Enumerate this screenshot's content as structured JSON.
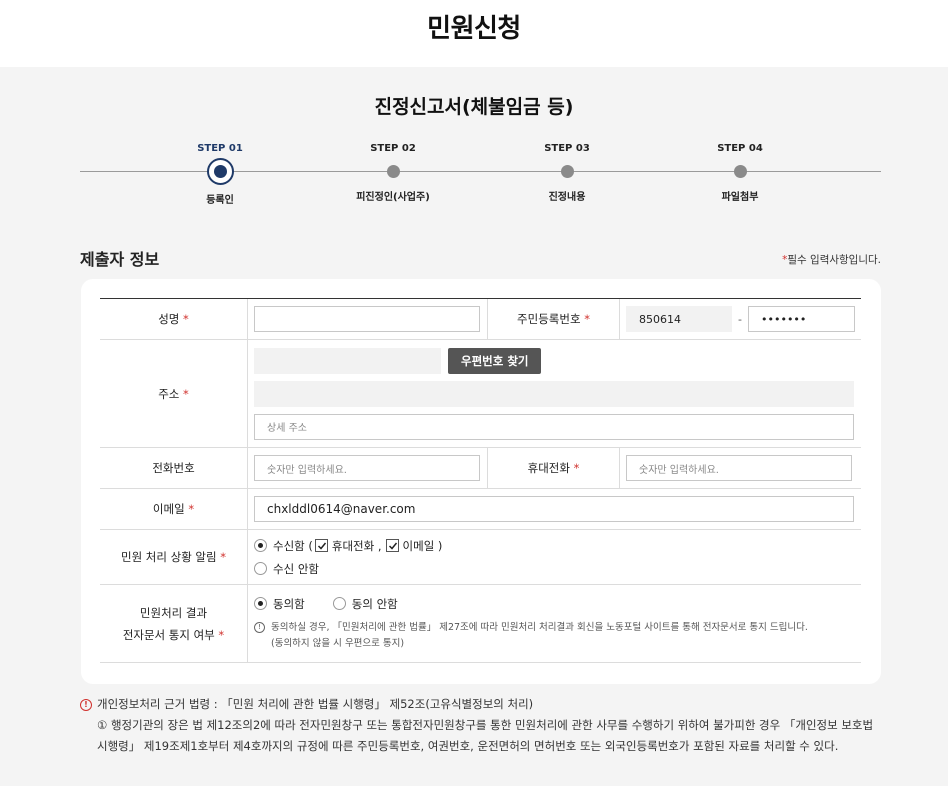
{
  "page": {
    "title": "민원신청",
    "form_title": "진정신고서(체불임금 등)"
  },
  "steps": [
    {
      "label": "STEP 01",
      "name": "등록인"
    },
    {
      "label": "STEP 02",
      "name": "피진정인(사업주)"
    },
    {
      "label": "STEP 03",
      "name": "진정내용"
    },
    {
      "label": "STEP 04",
      "name": "파일첨부"
    }
  ],
  "section": {
    "title": "제출자 정보",
    "required_star": "*",
    "required_note": "필수 입력사항입니다."
  },
  "fields": {
    "name": {
      "label": "성명",
      "value": ""
    },
    "rrn": {
      "label": "주민등록번호",
      "front": "850614",
      "sep": "-",
      "back": "•••••••"
    },
    "address": {
      "label": "주소",
      "zip_button": "우편번호 찾기",
      "detail_placeholder": "상세 주소"
    },
    "phone": {
      "label": "전화번호",
      "placeholder": "숫자만 입력하세요."
    },
    "mobile": {
      "label": "휴대전화",
      "placeholder": "숫자만 입력하세요."
    },
    "email": {
      "label": "이메일",
      "value": "chxlddl0614@naver.com"
    },
    "notify": {
      "label": "민원 처리 상황 알림",
      "receive": "수신함 (",
      "mobile": "휴대전화 ,",
      "email": "이메일 )",
      "no_receive": "수신 안함"
    },
    "edoc": {
      "label_line1": "민원처리 결과",
      "label_line2": "전자문서 통지 여부",
      "agree": "동의함",
      "disagree": "동의 안함",
      "notice_line1": "동의하실 경우, 「민원처리에 관한 법률」 제27조에 따라 민원처리 처리결과 회신을 노동포털 사이트를 통해 전자문서로 통지 드립니다.",
      "notice_line2": "(동의하지 않을 시 우편으로 통지)"
    }
  },
  "bottom_notice": {
    "head": "개인정보처리 근거 법령 : 「민원 처리에 관한 법률 시행령」 제52조(고유식별정보의 처리)",
    "body": "① 행정기관의 장은 법 제12조의2에 따라 전자민원창구 또는 통합전자민원창구를 통한 민원처리에 관한 사무를 수행하기 위하여 불가피한 경우 「개인정보 보호법 시행령」 제19조제1호부터 제4호까지의 규정에 따른 주민등록번호, 여권번호, 운전면허의 면허번호 또는 외국인등록번호가 포함된 자료를 처리할 수 있다."
  }
}
